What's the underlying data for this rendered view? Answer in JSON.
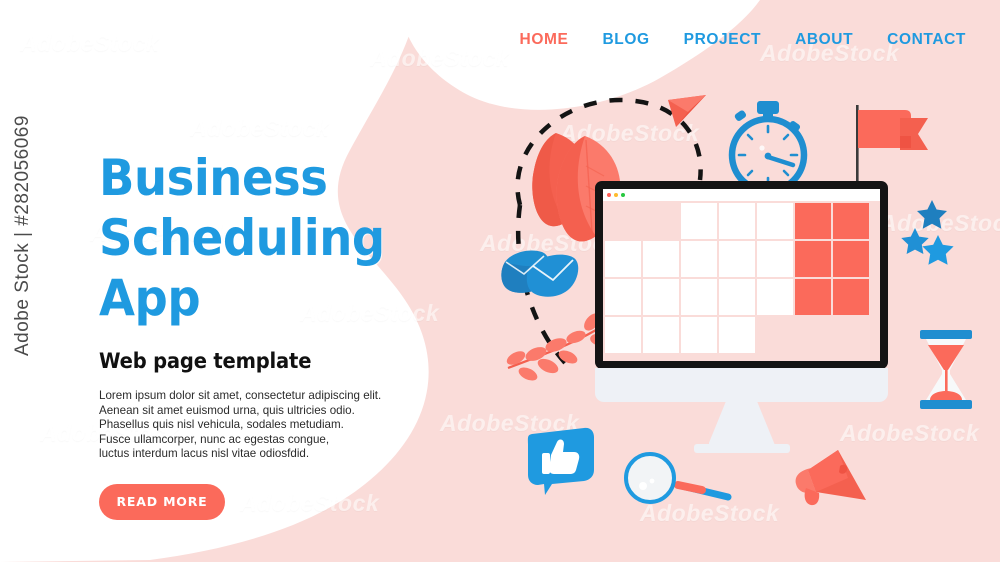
{
  "meta": {
    "watermark_side": "Adobe Stock | #282056069",
    "watermark_tile": "AdobeStock"
  },
  "colors": {
    "pink_bg": "#fadcd9",
    "white_bg": "#ffffff",
    "blue": "#1f9ae0",
    "coral": "#fb6a5b",
    "dark": "#141414",
    "bezel": "#eef1f6",
    "leaf_coral": "#f4604f",
    "text_dark": "#2b2b2b"
  },
  "nav": {
    "items": [
      {
        "label": "HOME",
        "active": true
      },
      {
        "label": "BLOG",
        "active": false
      },
      {
        "label": "PROJECT",
        "active": false
      },
      {
        "label": "ABOUT",
        "active": false
      },
      {
        "label": "CONTACT",
        "active": false
      }
    ]
  },
  "hero": {
    "title_line1": "Business",
    "title_line2": "Scheduling App",
    "subtitle": "Web page template",
    "paragraph_lines": [
      "Lorem ipsum dolor sit amet, consectetur adipiscing elit.",
      "Aenean sit amet euismod urna, quis ultricies odio.",
      "Phasellus quis nisl vehicula, sodales metudiam.",
      "Fusce ullamcorper, nunc ac egestas congue,",
      "luctus interdum lacus nisl vitae odiosfdid."
    ],
    "cta_label": "READ MORE"
  },
  "monitor": {
    "window_dots": [
      "#ff5f57",
      "#febc2e",
      "#28c840"
    ],
    "calendar": {
      "columns": 7,
      "rows": 4,
      "cells": [
        {
          "row": 0,
          "col": 0,
          "type": "empty",
          "icon": ""
        },
        {
          "row": 0,
          "col": 1,
          "type": "empty",
          "icon": ""
        },
        {
          "row": 0,
          "col": 2,
          "type": "white",
          "icon": ""
        },
        {
          "row": 0,
          "col": 3,
          "type": "white",
          "icon": "checkbox-checked-icon"
        },
        {
          "row": 0,
          "col": 4,
          "type": "white",
          "icon": ""
        },
        {
          "row": 0,
          "col": 5,
          "type": "coral",
          "icon": ""
        },
        {
          "row": 0,
          "col": 6,
          "type": "coral",
          "icon": ""
        },
        {
          "row": 1,
          "col": 0,
          "type": "white",
          "icon": ""
        },
        {
          "row": 1,
          "col": 1,
          "type": "white",
          "icon": ""
        },
        {
          "row": 1,
          "col": 2,
          "type": "white",
          "icon": "clock-icon"
        },
        {
          "row": 1,
          "col": 3,
          "type": "white",
          "icon": ""
        },
        {
          "row": 1,
          "col": 4,
          "type": "white",
          "icon": "star-icon"
        },
        {
          "row": 1,
          "col": 5,
          "type": "coral",
          "icon": ""
        },
        {
          "row": 1,
          "col": 6,
          "type": "coral",
          "icon": ""
        },
        {
          "row": 2,
          "col": 0,
          "type": "white",
          "icon": ""
        },
        {
          "row": 2,
          "col": 1,
          "type": "white",
          "icon": "checkbox-checked-icon"
        },
        {
          "row": 2,
          "col": 2,
          "type": "white",
          "icon": ""
        },
        {
          "row": 2,
          "col": 3,
          "type": "white",
          "icon": ""
        },
        {
          "row": 2,
          "col": 4,
          "type": "white",
          "icon": ""
        },
        {
          "row": 2,
          "col": 5,
          "type": "coral",
          "icon": ""
        },
        {
          "row": 2,
          "col": 6,
          "type": "coral",
          "icon": ""
        },
        {
          "row": 3,
          "col": 0,
          "type": "white",
          "icon": "chat-bubble-icon"
        },
        {
          "row": 3,
          "col": 1,
          "type": "white",
          "icon": ""
        },
        {
          "row": 3,
          "col": 2,
          "type": "white",
          "icon": ""
        },
        {
          "row": 3,
          "col": 3,
          "type": "white",
          "icon": "checkbox-checked-icon"
        },
        {
          "row": 3,
          "col": 4,
          "type": "empty",
          "icon": ""
        },
        {
          "row": 3,
          "col": 5,
          "type": "empty",
          "icon": ""
        },
        {
          "row": 3,
          "col": 6,
          "type": "empty",
          "icon": ""
        }
      ]
    }
  },
  "decorations": [
    {
      "name": "stopwatch-icon",
      "color": "#1f9ae0"
    },
    {
      "name": "flag-icon",
      "color": "#fb6a5b"
    },
    {
      "name": "paper-plane-icon",
      "color": "#f4604f"
    },
    {
      "name": "leaf-icon",
      "color": "#f4604f"
    },
    {
      "name": "dashed-trail",
      "color": "#141414"
    },
    {
      "name": "origami-envelope-icon",
      "color": "#1f8ed0"
    },
    {
      "name": "branch-leaves-icon",
      "color": "#f4604f"
    },
    {
      "name": "thumbs-up-bubble-icon",
      "color": "#1f9ae0"
    },
    {
      "name": "magnifier-icon",
      "color": "#1f9ae0"
    },
    {
      "name": "megaphone-icon",
      "color": "#fb6a5b"
    },
    {
      "name": "hourglass-icon",
      "color": "#fb6a5b"
    },
    {
      "name": "star-icon",
      "color": "#1f8ed0"
    }
  ]
}
